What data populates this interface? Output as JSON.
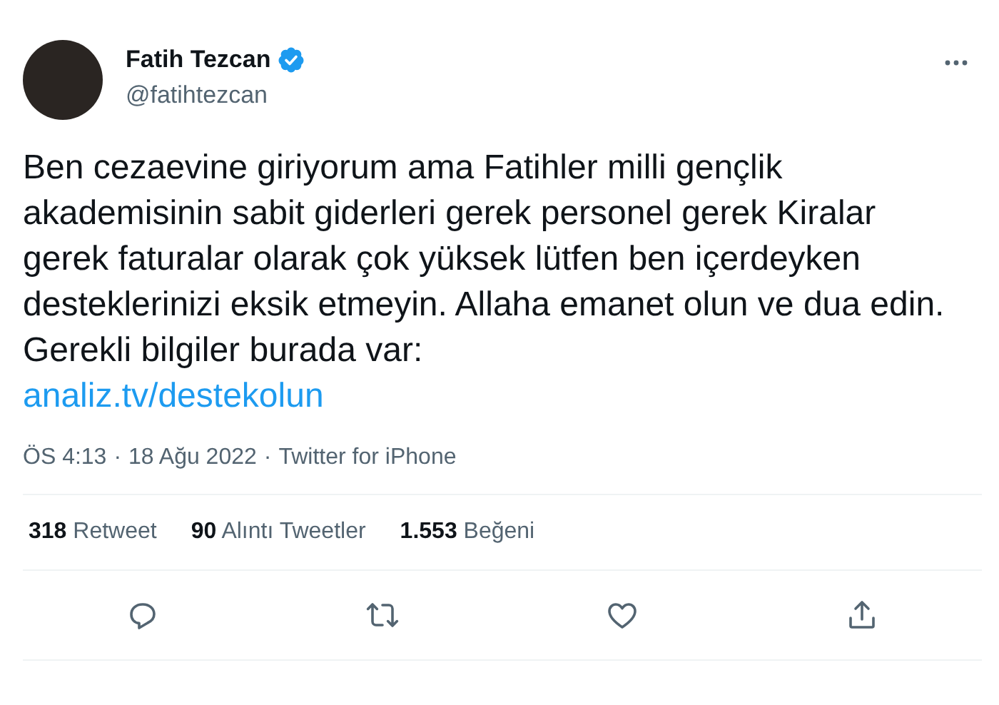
{
  "author": {
    "name": "Fatih Tezcan",
    "verified": true,
    "handle": "@fatihtezcan"
  },
  "tweet": {
    "text": "Ben cezaevine giriyorum ama Fatihler milli gençlik akademisinin sabit giderleri gerek personel gerek Kiralar gerek faturalar olarak çok yüksek lütfen ben içerdeyken desteklerinizi eksik etmeyin. Allaha emanet olun ve dua edin. Gerekli bilgiler burada var:",
    "link": "analiz.tv/destekolun"
  },
  "meta": {
    "time": "ÖS 4:13",
    "separator_1": "·",
    "date": "18 Ağu 2022",
    "separator_2": "·",
    "source": "Twitter for iPhone"
  },
  "stats": [
    {
      "count": "318",
      "label": "Retweet"
    },
    {
      "count": "90",
      "label": "Alıntı Tweetler"
    },
    {
      "count": "1.553",
      "label": "Beğeni"
    }
  ],
  "actions": [
    {
      "kind": "reply"
    },
    {
      "kind": "retweet"
    },
    {
      "kind": "like"
    },
    {
      "kind": "share"
    }
  ]
}
